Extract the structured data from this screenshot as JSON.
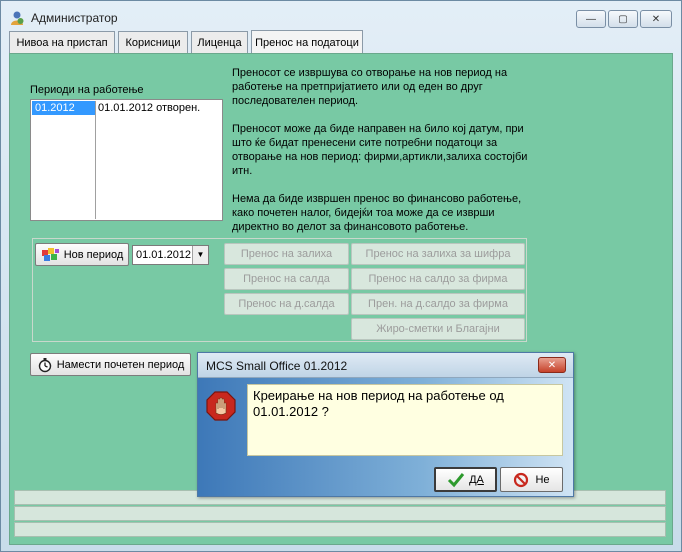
{
  "window": {
    "title": "Администратор",
    "min_glyph": "—",
    "max_glyph": "▢",
    "close_glyph": "✕"
  },
  "tabs": [
    {
      "label": "Нивоа на пристап",
      "active": false
    },
    {
      "label": "Корисници",
      "active": false
    },
    {
      "label": "Лиценца",
      "active": false
    },
    {
      "label": "Пренос на податоци",
      "active": true
    }
  ],
  "periods": {
    "label": "Периоди на работење",
    "rows": [
      {
        "period": "01.2012",
        "status": "01.01.2012 отворен."
      }
    ]
  },
  "info": {
    "p1": "Преносот се извршува со отворање на нов период на работење на претпријатието или од еден во друг последователен период.",
    "p2": "Преносот може да биде направен на било кој датум, при што ќе бидат пренесени сите потребни податоци за отворање на нов период: фирми,артикли,залиха состојби итн.",
    "p3": "Нема да биде извршен пренос во финансово работење, како почетен налог, бидејќи тоа може да се изврши директно во делот за финансовото работење."
  },
  "controls": {
    "new_period_label": "Нов период",
    "date_value": "01.01.2012",
    "set_initial_label": "Намести почетен период",
    "transfer_buttons": [
      "Пренос на залиха",
      "Пренос на залиха за шифра",
      "Пренос на салда",
      "Пренос на салдо за фирма",
      "Пренос на д.салда",
      "Прен. на д.салдо за фирма",
      "Жиро-сметки и Благајни"
    ]
  },
  "dialog": {
    "title": "MCS Small Office 01.2012",
    "message": "Креирање на нов период на работење од 01.01.2012 ?",
    "yes_label": "ДА",
    "no_label": "Не"
  },
  "colors": {
    "client_bg": "#78c9a4",
    "selection": "#3399ff",
    "message_bg": "#ffffe1"
  }
}
